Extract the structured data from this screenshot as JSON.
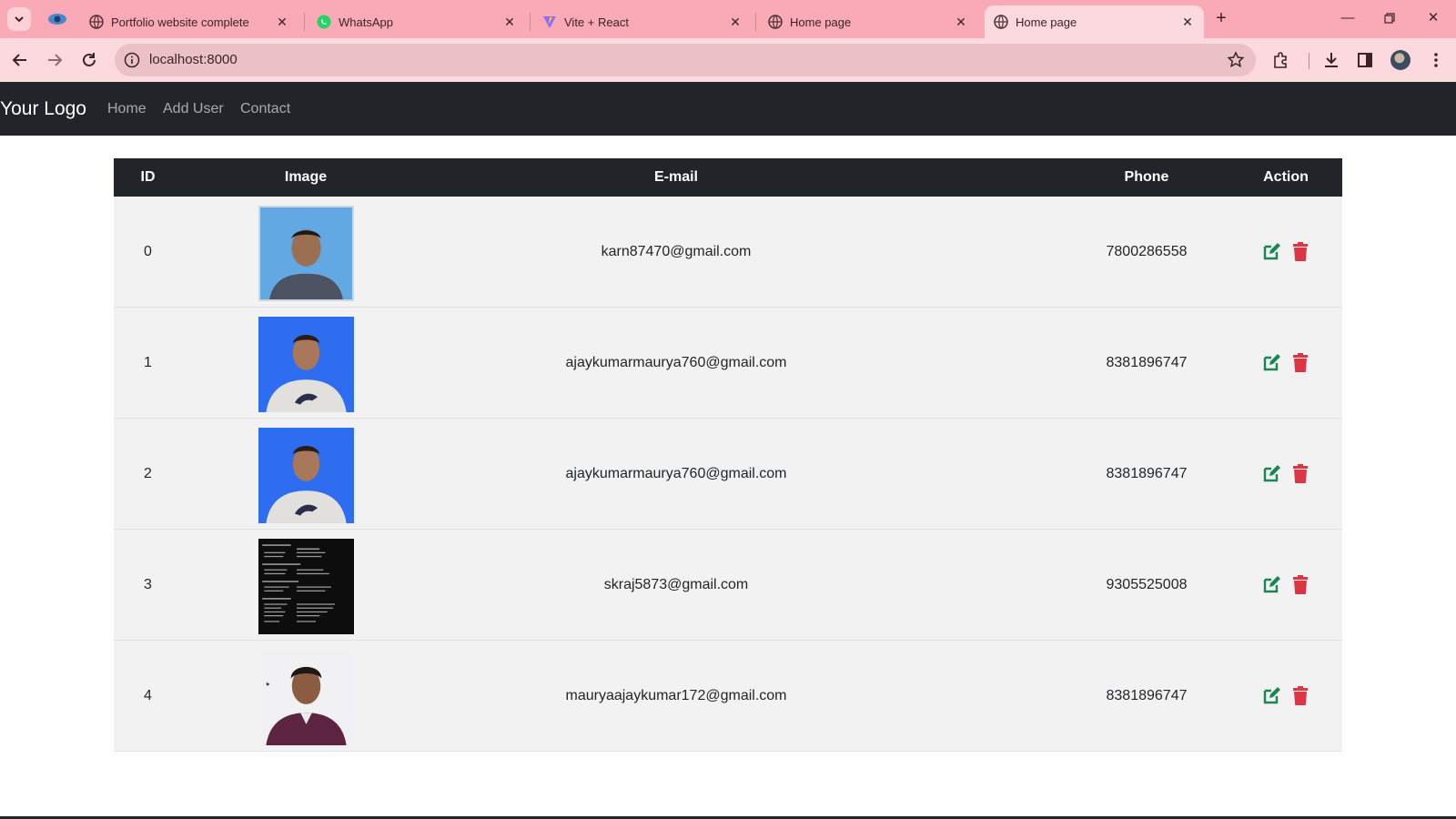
{
  "browser": {
    "tabs": [
      {
        "title": "Portfolio website complete",
        "icon": "globe-icon"
      },
      {
        "title": "WhatsApp",
        "icon": "whatsapp-icon"
      },
      {
        "title": "Vite + React",
        "icon": "vite-icon"
      },
      {
        "title": "Home page",
        "icon": "globe-icon"
      },
      {
        "title": "Home page",
        "icon": "globe-icon",
        "active": true
      }
    ],
    "url": "localhost:8000",
    "colors": {
      "tabbar": "#f9aab6",
      "toolbar": "#fcd9de",
      "omnibox": "#ebc1c7"
    }
  },
  "navbar": {
    "brand": "Your Logo",
    "links": [
      "Home",
      "Add User",
      "Contact"
    ],
    "background": "#212529"
  },
  "table": {
    "columns": [
      "ID",
      "Image",
      "E-mail",
      "Phone",
      "Action"
    ],
    "rows": [
      {
        "id": "0",
        "image": "user-photo-blue-background",
        "email": "karn87470@gmail.com",
        "phone": "7800286558"
      },
      {
        "id": "1",
        "image": "user-photo-blue-background",
        "email": "ajaykumarmaurya760@gmail.com",
        "phone": "8381896747"
      },
      {
        "id": "2",
        "image": "user-photo-blue-background",
        "email": "ajaykumarmaurya760@gmail.com",
        "phone": "8381896747"
      },
      {
        "id": "3",
        "image": "terminal-screenshot",
        "email": "skraj5873@gmail.com",
        "phone": "9305525008"
      },
      {
        "id": "4",
        "image": "user-photo-white-background",
        "email": "mauryaajaykumar172@gmail.com",
        "phone": "8381896747"
      }
    ],
    "actions": {
      "edit_icon": "edit-icon",
      "delete_icon": "trash-icon",
      "edit_color": "#198754",
      "delete_color": "#dc3545"
    }
  }
}
